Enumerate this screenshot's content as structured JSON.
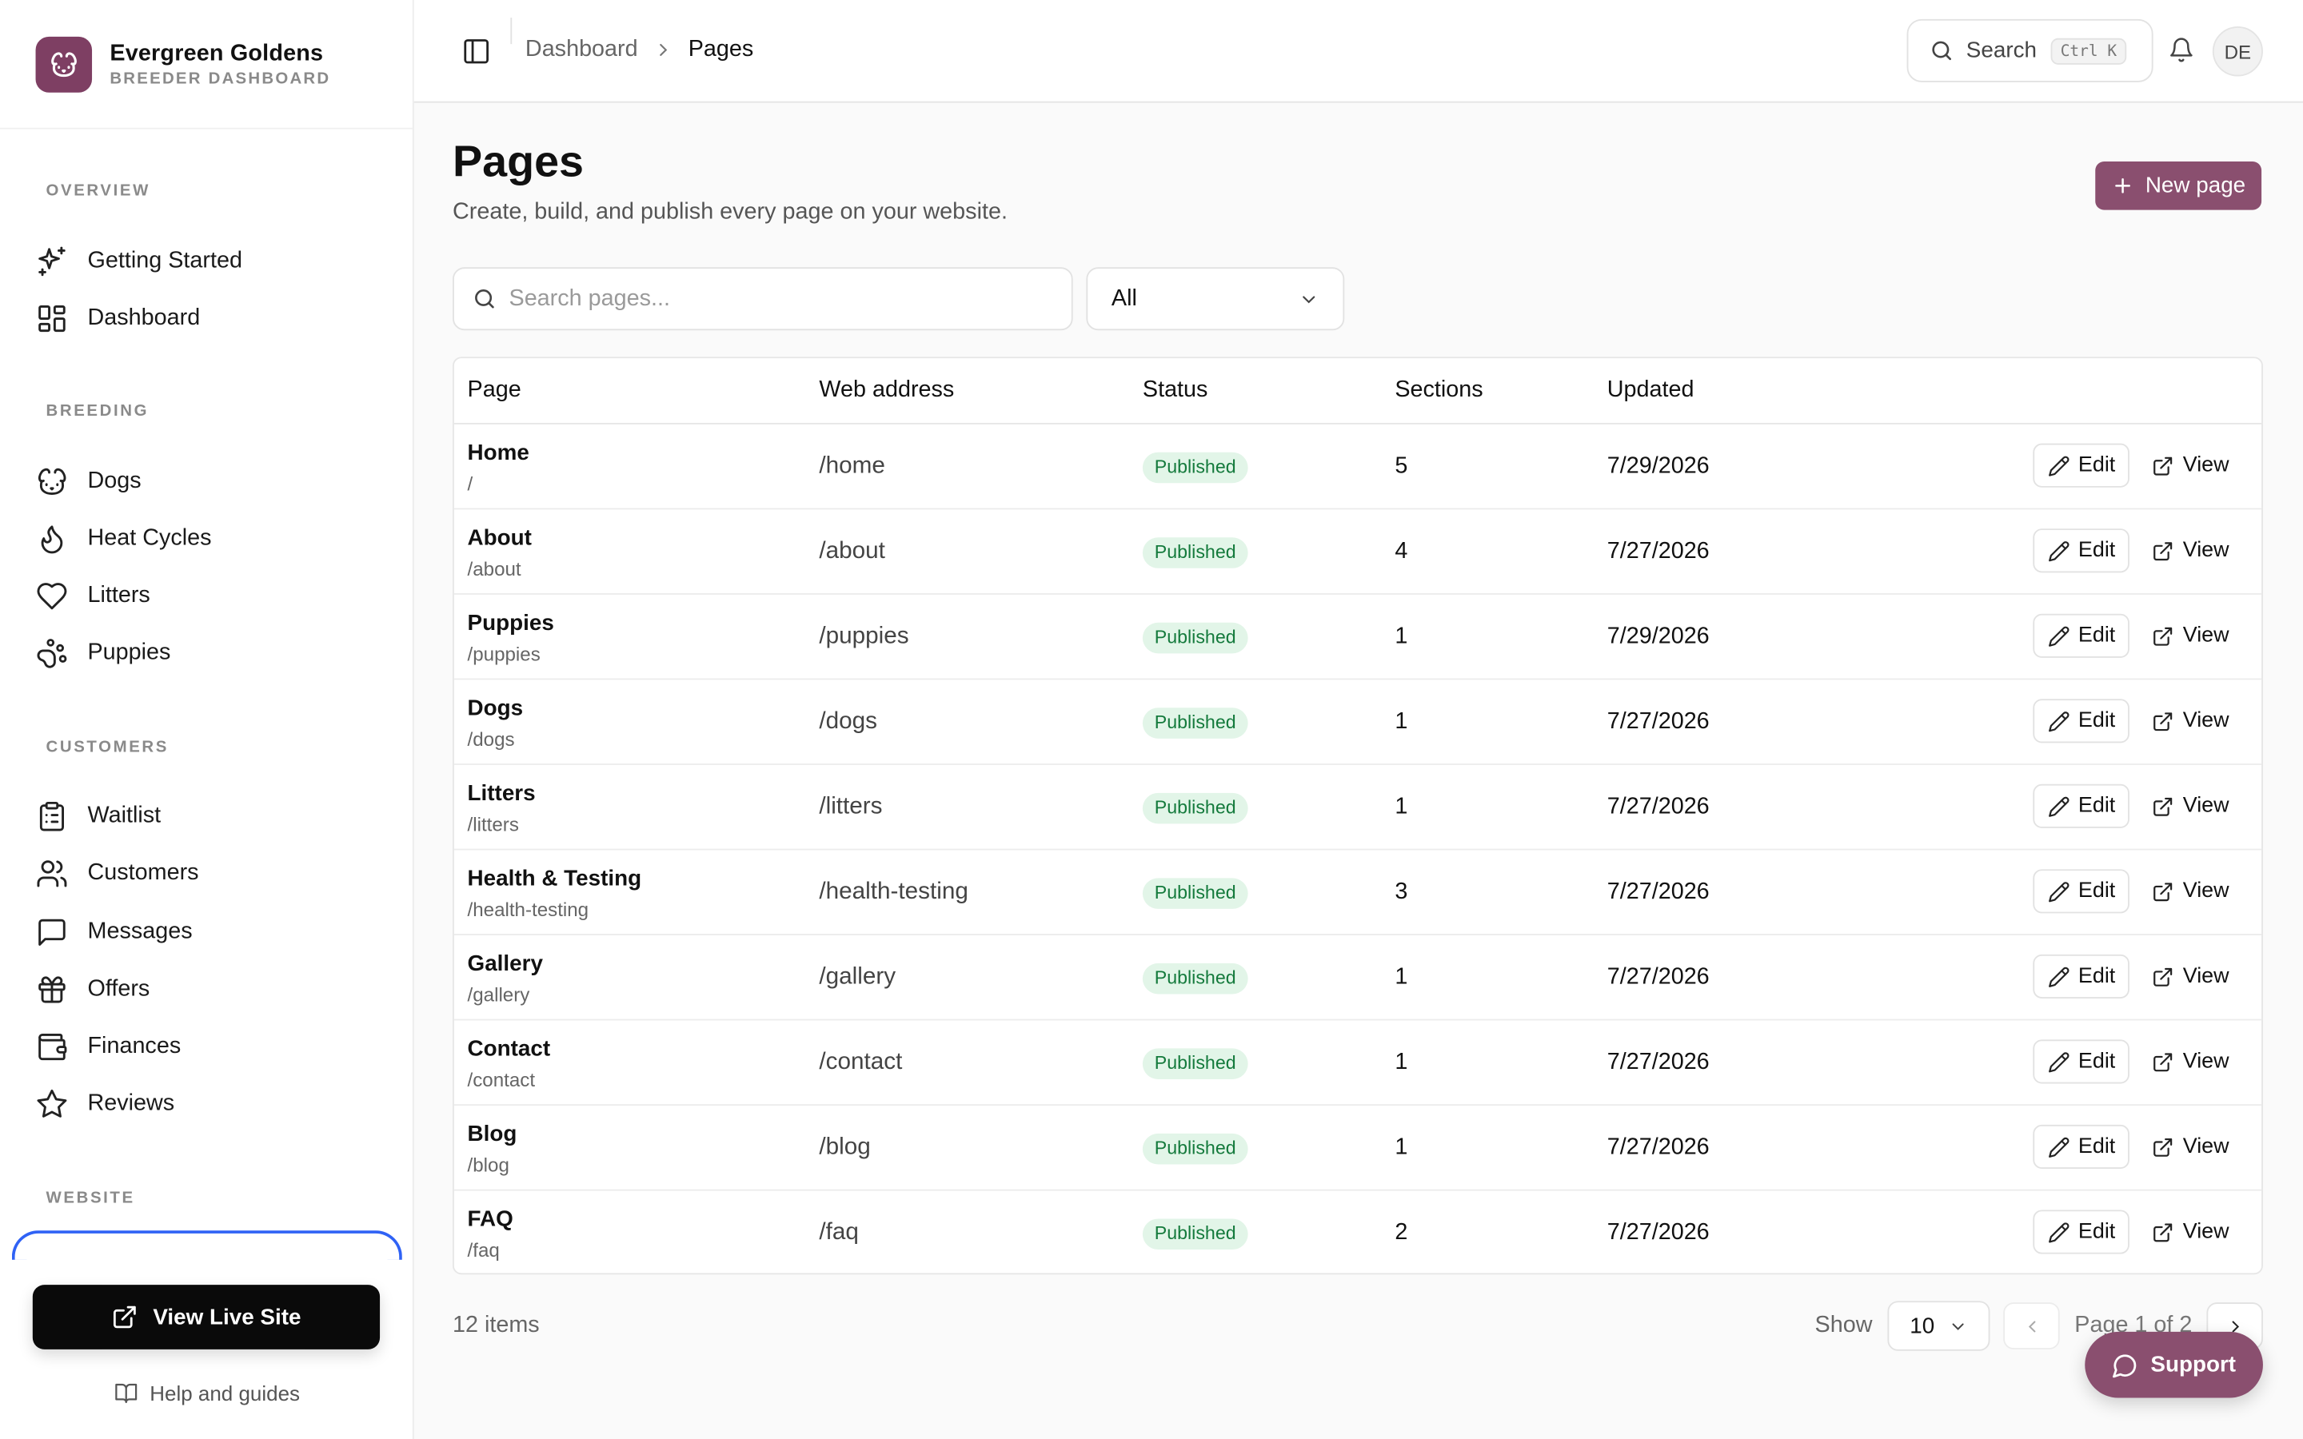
{
  "brand": {
    "name": "Evergreen Goldens",
    "subtitle": "BREEDER DASHBOARD",
    "logo_icon": "dog-face-icon",
    "accent": "#7e3f63"
  },
  "sidebar": {
    "sections": [
      {
        "label": "OVERVIEW",
        "items": [
          {
            "label": "Getting Started",
            "icon": "sparkles-icon"
          },
          {
            "label": "Dashboard",
            "icon": "layout-grid-icon"
          }
        ]
      },
      {
        "label": "BREEDING",
        "items": [
          {
            "label": "Dogs",
            "icon": "dog-icon"
          },
          {
            "label": "Heat Cycles",
            "icon": "flame-icon"
          },
          {
            "label": "Litters",
            "icon": "heart-icon"
          },
          {
            "label": "Puppies",
            "icon": "paw-print-icon"
          }
        ]
      },
      {
        "label": "CUSTOMERS",
        "items": [
          {
            "label": "Waitlist",
            "icon": "clipboard-list-icon"
          },
          {
            "label": "Customers",
            "icon": "users-icon"
          },
          {
            "label": "Messages",
            "icon": "message-square-icon"
          },
          {
            "label": "Offers",
            "icon": "gift-icon"
          },
          {
            "label": "Finances",
            "icon": "wallet-icon"
          },
          {
            "label": "Reviews",
            "icon": "star-icon"
          }
        ]
      },
      {
        "label": "WEBSITE",
        "items": []
      }
    ],
    "view_live_site": "View Live Site",
    "help": "Help and guides"
  },
  "topbar": {
    "breadcrumb": [
      "Dashboard",
      "Pages"
    ],
    "search_label": "Search",
    "search_shortcut": "Ctrl K",
    "avatar_initials": "DE"
  },
  "page": {
    "title": "Pages",
    "subtitle": "Create, build, and publish every page on your website.",
    "new_button": "New page",
    "search_placeholder": "Search pages...",
    "filter_value": "All"
  },
  "table": {
    "columns": [
      "Page",
      "Web address",
      "Status",
      "Sections",
      "Updated"
    ],
    "edit_label": "Edit",
    "view_label": "View",
    "rows": [
      {
        "name": "Home",
        "slug": "/",
        "address": "/home",
        "status": "Published",
        "sections": "5",
        "updated": "7/29/2026"
      },
      {
        "name": "About",
        "slug": "/about",
        "address": "/about",
        "status": "Published",
        "sections": "4",
        "updated": "7/27/2026"
      },
      {
        "name": "Puppies",
        "slug": "/puppies",
        "address": "/puppies",
        "status": "Published",
        "sections": "1",
        "updated": "7/29/2026"
      },
      {
        "name": "Dogs",
        "slug": "/dogs",
        "address": "/dogs",
        "status": "Published",
        "sections": "1",
        "updated": "7/27/2026"
      },
      {
        "name": "Litters",
        "slug": "/litters",
        "address": "/litters",
        "status": "Published",
        "sections": "1",
        "updated": "7/27/2026"
      },
      {
        "name": "Health & Testing",
        "slug": "/health-testing",
        "address": "/health-testing",
        "status": "Published",
        "sections": "3",
        "updated": "7/27/2026"
      },
      {
        "name": "Gallery",
        "slug": "/gallery",
        "address": "/gallery",
        "status": "Published",
        "sections": "1",
        "updated": "7/27/2026"
      },
      {
        "name": "Contact",
        "slug": "/contact",
        "address": "/contact",
        "status": "Published",
        "sections": "1",
        "updated": "7/27/2026"
      },
      {
        "name": "Blog",
        "slug": "/blog",
        "address": "/blog",
        "status": "Published",
        "sections": "1",
        "updated": "7/27/2026"
      },
      {
        "name": "FAQ",
        "slug": "/faq",
        "address": "/faq",
        "status": "Published",
        "sections": "2",
        "updated": "7/27/2026"
      }
    ]
  },
  "footer": {
    "items_count": "12 items",
    "show_label": "Show",
    "page_size": "10",
    "page_info": "Page 1 of 2",
    "support": "Support"
  },
  "colors": {
    "primary": "#8a4f6f",
    "published_bg": "#e2f5e8",
    "published_text": "#147a3c",
    "active_outline": "#2f62f5"
  }
}
